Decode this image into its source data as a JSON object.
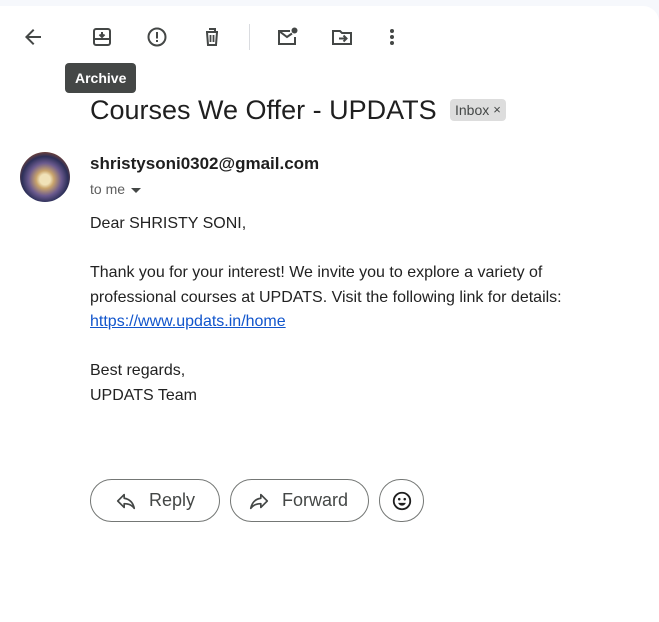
{
  "toolbar": {
    "tooltip": "Archive"
  },
  "message": {
    "subject": "Courses We Offer - UPDATS",
    "label": "Inbox",
    "label_close": "×",
    "sender": "shristysoni0302@gmail.com",
    "recipient": "to me",
    "greeting": "Dear SHRISTY SONI,",
    "paragraph_line1": "Thank you for your interest! We invite you to explore a variety of",
    "paragraph_line2": "professional courses at UPDATS. Visit the following link for details:",
    "link": "https://www.updats.in/home",
    "closing": "Best regards,",
    "signature": "UPDATS Team"
  },
  "actions": {
    "reply": "Reply",
    "forward": "Forward"
  }
}
